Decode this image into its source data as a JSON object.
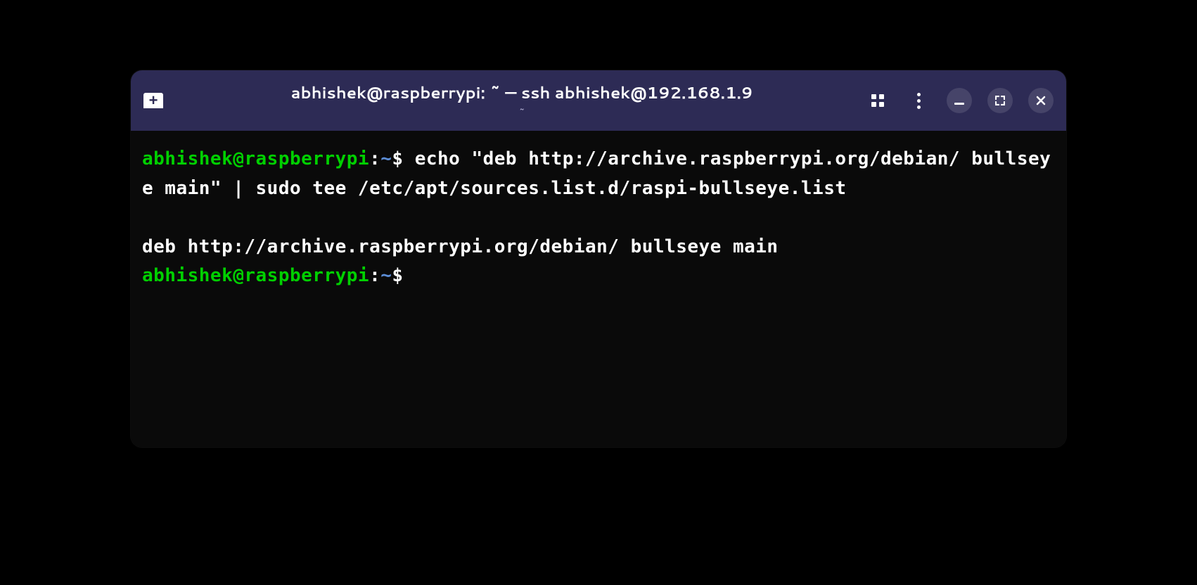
{
  "titlebar": {
    "title": "abhishek@raspberrypi: ~ — ssh abhishek@192.168.1.9",
    "subtitle": "~"
  },
  "terminal": {
    "lines": [
      {
        "prompt": {
          "user_host": "abhishek@raspberrypi",
          "colon": ":",
          "path": "~",
          "dollar": "$"
        },
        "command": "echo \"deb http://archive.raspberrypi.org/debian/ bullseye main\" | sudo tee /etc/apt/sources.list.d/raspi-bullseye.list"
      },
      {
        "blank": true
      },
      {
        "output": "deb http://archive.raspberrypi.org/debian/ bullseye main"
      },
      {
        "prompt": {
          "user_host": "abhishek@raspberrypi",
          "colon": ":",
          "path": "~",
          "dollar": "$"
        },
        "command": ""
      }
    ]
  },
  "colors": {
    "titlebar_bg": "#2d2b55",
    "terminal_bg": "#0a0a0a",
    "prompt_user": "#00d000",
    "prompt_path": "#5c8dd6",
    "text": "#ffffff"
  },
  "icons": {
    "new_tab": "new-tab-icon",
    "grid": "grid-icon",
    "menu": "more-vertical-icon",
    "minimize": "minimize-icon",
    "maximize": "maximize-icon",
    "close": "close-icon"
  }
}
